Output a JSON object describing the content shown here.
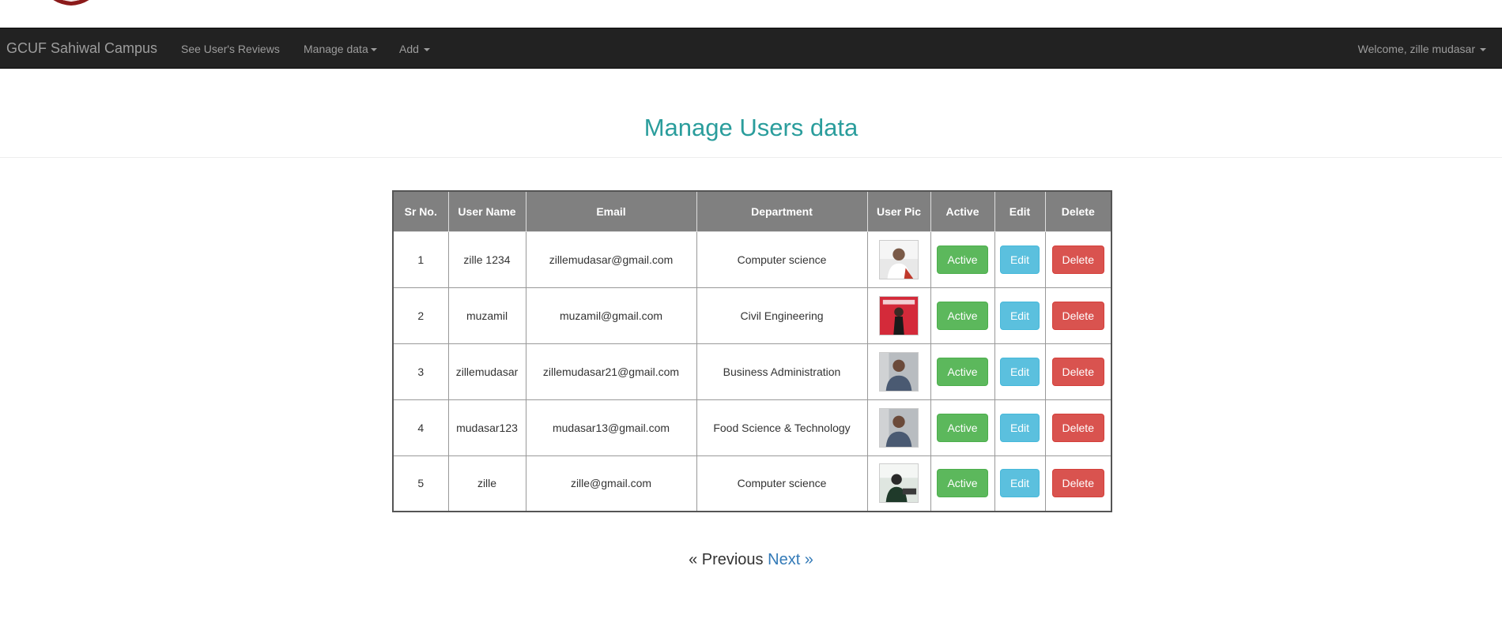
{
  "navbar": {
    "brand": "GCUF Sahiwal Campus",
    "items": [
      {
        "label": "See User's Reviews"
      },
      {
        "label": "Manage data"
      },
      {
        "label": "Add"
      }
    ],
    "welcome": "Welcome, zille mudasar"
  },
  "page": {
    "title": "Manage Users data"
  },
  "table": {
    "headers": [
      "Sr No.",
      "User Name",
      "Email",
      "Department",
      "User Pic",
      "Active",
      "Edit",
      "Delete"
    ],
    "rows": [
      {
        "sr": "1",
        "name": "zille 1234",
        "email": "zillemudasar@gmail.com",
        "department": "Computer science",
        "active": "Active",
        "edit": "Edit",
        "delete": "Delete"
      },
      {
        "sr": "2",
        "name": "muzamil",
        "email": "muzamil@gmail.com",
        "department": "Civil Engineering",
        "active": "Active",
        "edit": "Edit",
        "delete": "Delete"
      },
      {
        "sr": "3",
        "name": "zillemudasar",
        "email": "zillemudasar21@gmail.com",
        "department": "Business Administration",
        "active": "Active",
        "edit": "Edit",
        "delete": "Delete"
      },
      {
        "sr": "4",
        "name": "mudasar123",
        "email": "mudasar13@gmail.com",
        "department": "Food Science & Technology",
        "active": "Active",
        "edit": "Edit",
        "delete": "Delete"
      },
      {
        "sr": "5",
        "name": "zille",
        "email": "zille@gmail.com",
        "department": "Computer science",
        "active": "Active",
        "edit": "Edit",
        "delete": "Delete"
      }
    ]
  },
  "pagination": {
    "previous": "« Previous",
    "next": "Next »"
  },
  "colors": {
    "navbar_bg": "#222222",
    "title": "#2a9d9c",
    "header_bg": "#808080",
    "active_btn": "#5cb85c",
    "edit_btn": "#5bc0de",
    "delete_btn": "#d9534f",
    "link": "#337ab7"
  }
}
